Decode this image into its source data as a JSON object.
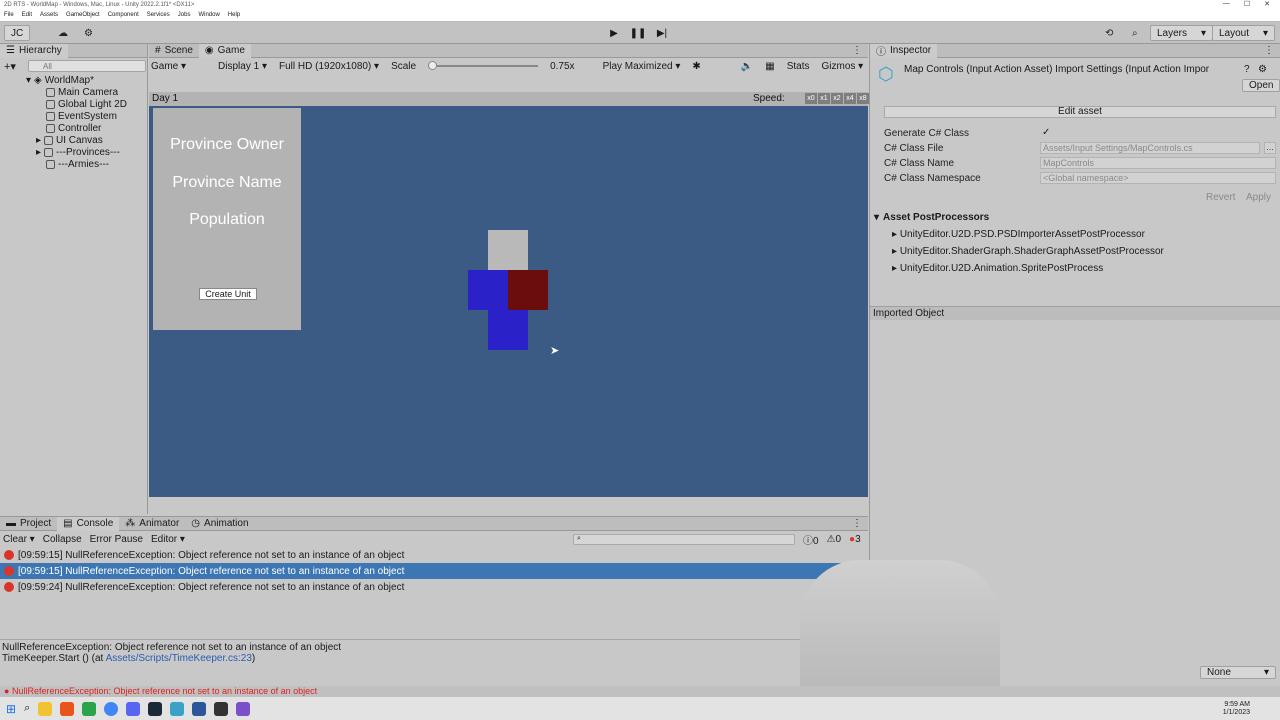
{
  "window": {
    "title": "2D RTS - WorldMap - Windows, Mac, Linux - Unity 2022.2.1f1* <DX11>"
  },
  "menubar": [
    "File",
    "Edit",
    "Assets",
    "GameObject",
    "Component",
    "Services",
    "Jobs",
    "Window",
    "Help"
  ],
  "toolbar": {
    "account": "JC",
    "layers": "Layers",
    "layout": "Layout"
  },
  "hierarchy": {
    "tab": "Hierarchy",
    "search_placeholder": "All",
    "root": "WorldMap*",
    "items": [
      "Main Camera",
      "Global Light 2D",
      "EventSystem",
      "Controller",
      "UI Canvas",
      "---Provinces---",
      "---Armies---"
    ]
  },
  "scene_tabs": {
    "scene": "Scene",
    "game": "Game"
  },
  "game_toolbar": {
    "mode": "Game",
    "display": "Display 1",
    "resolution": "Full HD (1920x1080)",
    "scale_label": "Scale",
    "scale_value": "0.75x",
    "play_mode": "Play Maximized",
    "stats": "Stats",
    "gizmos": "Gizmos"
  },
  "game": {
    "day": "Day 1",
    "speed_label": "Speed:",
    "speed_buttons": [
      "x0",
      "x1",
      "x2",
      "x4",
      "x8"
    ],
    "province_owner": "Province Owner",
    "province_name": "Province Name",
    "population": "Population",
    "create_unit": "Create Unit",
    "colors": {
      "background": "#3b5b85",
      "panel": "#b3b3b3",
      "grey": "#b9b9b9",
      "blue": "#2a21c9",
      "red": "#6b0d0d"
    }
  },
  "inspector": {
    "tab": "Inspector",
    "title": "Map Controls (Input Action Asset) Import Settings (Input Action Impor",
    "open": "Open",
    "edit_asset": "Edit asset",
    "fields": [
      {
        "label": "Generate C# Class",
        "value": "✓"
      },
      {
        "label": "C# Class File",
        "value": "Assets/Input Settings/MapControls.cs"
      },
      {
        "label": "C# Class Name",
        "value": "MapControls"
      },
      {
        "label": "C# Class Namespace",
        "value": "<Global namespace>"
      }
    ],
    "revert": "Revert",
    "apply": "Apply",
    "postprocessors_header": "Asset PostProcessors",
    "postprocessors": [
      "UnityEditor.U2D.PSD.PSDImporterAssetPostProcessor",
      "UnityEditor.ShaderGraph.ShaderGraphAssetPostProcessor",
      "UnityEditor.U2D.Animation.SpritePostProcess"
    ],
    "imported_object": "Imported Object",
    "bottom_dropdown": "None"
  },
  "bottom_tabs": [
    "Project",
    "Console",
    "Animator",
    "Animation"
  ],
  "console": {
    "clear": "Clear",
    "collapse": "Collapse",
    "error_pause": "Error Pause",
    "editor": "Editor",
    "count_log": "0",
    "count_warn": "0",
    "count_err": "3",
    "rows": [
      "[09:59:15] NullReferenceException: Object reference not set to an instance of an object",
      "[09:59:15] NullReferenceException: Object reference not set to an instance of an object",
      "[09:59:24] NullReferenceException: Object reference not set to an instance of an object"
    ],
    "detail_line1": "NullReferenceException: Object reference not set to an instance of an object",
    "detail_line2_prefix": "TimeKeeper.Start () (at ",
    "detail_line2_link": "Assets/Scripts/TimeKeeper.cs:23",
    "detail_line2_suffix": ")"
  },
  "statusbar": {
    "message": "NullReferenceException: Object reference not set to an instance of an object"
  },
  "clock": {
    "time": "9:59 AM",
    "date": "1/1/2023"
  }
}
